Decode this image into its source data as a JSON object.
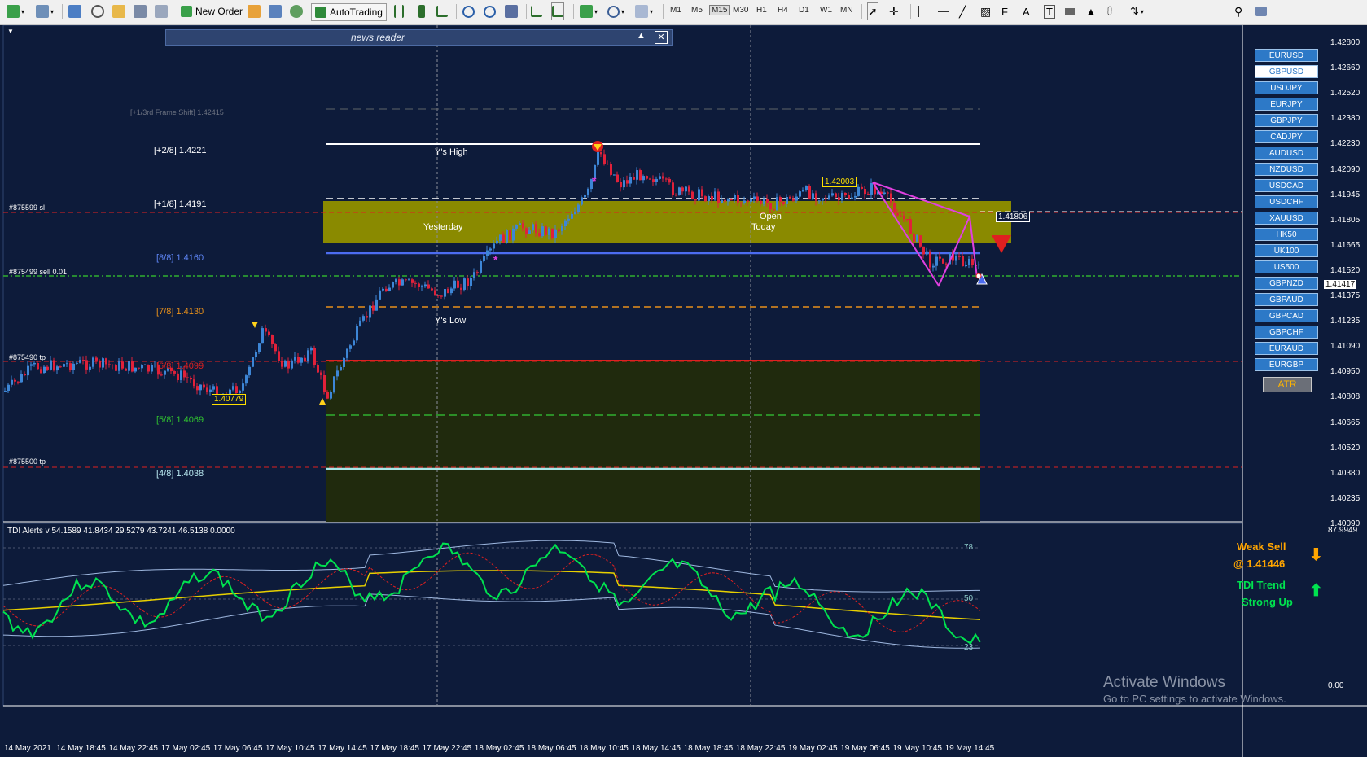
{
  "toolbar": {
    "new_order": "New Order",
    "autotrading": "AutoTrading",
    "timeframes": [
      "M1",
      "M5",
      "M15",
      "M30",
      "H1",
      "H4",
      "D1",
      "W1",
      "MN"
    ],
    "active_timeframe": "M15"
  },
  "news_reader": {
    "title": "news reader"
  },
  "levels": {
    "frame_shift": "[+1/3rd Frame Shift]  1.42415",
    "p28": "[+2/8]  1.4221",
    "p18": "[+1/8]  1.4191",
    "l88": "[8/8]  1.4160",
    "l78": "[7/8]  1.4130",
    "l68": "[6/8]  1.4099",
    "l58": "[5/8]  1.4069",
    "l48": "[4/8]  1.4038"
  },
  "annotations": {
    "ys_high": "Y's High",
    "ys_low": "Y's Low",
    "yesterday": "Yesterday",
    "open": "Open",
    "today": "Today",
    "price_1_42003": "1.42003",
    "price_1_40779": "1.40779",
    "price_1_41806": "1.41806"
  },
  "orders": {
    "sl": "#875599 sl",
    "sell": "#875499 sell 0.01",
    "tp1": "#875490 tp",
    "tp2": "#875500 tp"
  },
  "price_axis": [
    "1.42800",
    "1.42660",
    "1.42520",
    "1.42380",
    "1.42230",
    "1.42090",
    "1.41945",
    "1.41805",
    "1.41665",
    "1.41520",
    "1.41375",
    "1.41235",
    "1.41090",
    "1.40950",
    "1.40808",
    "1.40665",
    "1.40520",
    "1.40380",
    "1.40235",
    "1.40090"
  ],
  "current_price": "1.41417",
  "date_axis": [
    "14 May 2021",
    "14 May 18:45",
    "14 May 22:45",
    "17 May 02:45",
    "17 May 06:45",
    "17 May 10:45",
    "17 May 14:45",
    "17 May 18:45",
    "17 May 22:45",
    "18 May 02:45",
    "18 May 06:45",
    "18 May 10:45",
    "18 May 14:45",
    "18 May 18:45",
    "18 May 22:45",
    "19 May 02:45",
    "19 May 06:45",
    "19 May 10:45",
    "19 May 14:45"
  ],
  "symbols": [
    "EURUSD",
    "GBPUSD",
    "USDJPY",
    "EURJPY",
    "GBPJPY",
    "CADJPY",
    "AUDUSD",
    "NZDUSD",
    "USDCAD",
    "USDCHF",
    "XAUUSD",
    "HK50",
    "UK100",
    "US500",
    "GBPNZD",
    "GBPAUD",
    "GBPCAD",
    "GBPCHF",
    "EURAUD",
    "EURGBP"
  ],
  "selected_symbol": "GBPUSD",
  "atr_label": "ATR",
  "tdi": {
    "header": "TDI Alerts v 54.1589 41.8434 29.5279 43.7241 46.5138 0.0000",
    "axis_top": "87.9949",
    "axis_bottom": "0.00",
    "level_78": "78",
    "level_50": "50",
    "level_23": "23",
    "signal": "Weak Sell",
    "signal_price": "@ 1.41446",
    "trend_label": "TDI Trend",
    "trend_value": "Strong Up"
  },
  "watermark": {
    "line1": "Activate Windows",
    "line2": "Go to PC settings to activate Windows."
  },
  "colors": {
    "background": "#0d1b3a",
    "bull": "#3d86d6",
    "bear": "#e0213a",
    "zone": "#8a8a00",
    "tdi_green": "#00e24f",
    "tdi_yellow": "#e8d000",
    "signal_orange": "#ffa500"
  }
}
